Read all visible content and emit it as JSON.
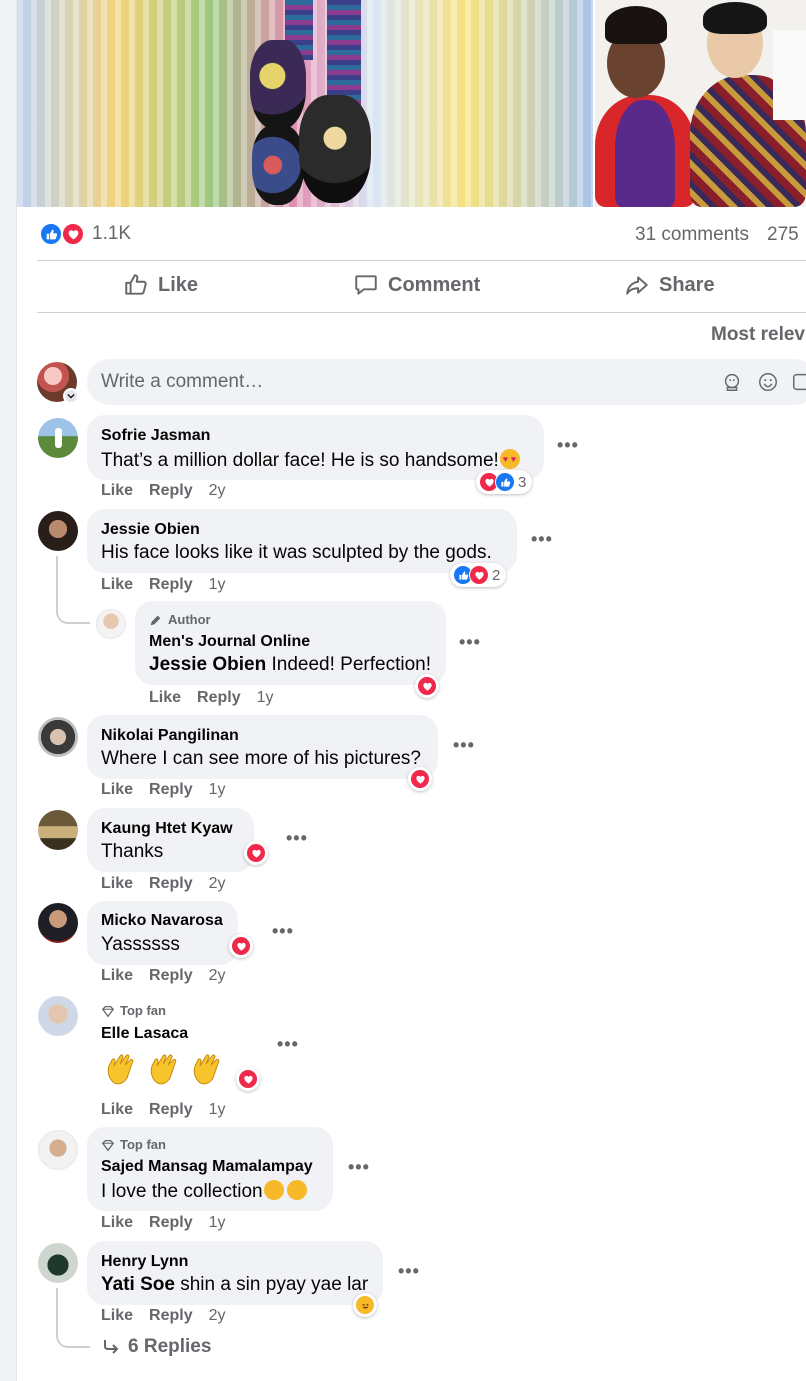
{
  "post": {
    "reaction_count": "1.1K",
    "comments_count": "31 comments",
    "shares_count": "275",
    "actions": {
      "like": "Like",
      "comment": "Comment",
      "share": "Share"
    },
    "sort_label": "Most relev"
  },
  "composer": {
    "placeholder": "Write a comment…"
  },
  "comments": [
    {
      "name": "Sofrie Jasman",
      "text": "That’s a million dollar face! He is so handsome!",
      "like": "Like",
      "reply": "Reply",
      "time": "2y",
      "reaction_count": "3"
    },
    {
      "name": "Jessie Obien",
      "text": "His face looks like it was sculpted by the gods.",
      "like": "Like",
      "reply": "Reply",
      "time": "1y",
      "reaction_count": "2"
    },
    {
      "badge": "Author",
      "name": "Men's Journal Online",
      "mention": "Jessie Obien",
      "text": " Indeed! Perfection!",
      "like": "Like",
      "reply": "Reply",
      "time": "1y"
    },
    {
      "name": "Nikolai Pangilinan",
      "text": "Where I can see more of his pictures?",
      "like": "Like",
      "reply": "Reply",
      "time": "1y"
    },
    {
      "name": "Kaung Htet Kyaw",
      "text": "Thanks",
      "like": "Like",
      "reply": "Reply",
      "time": "2y"
    },
    {
      "name": "Micko Navarosa",
      "text": "Yassssss",
      "like": "Like",
      "reply": "Reply",
      "time": "2y"
    },
    {
      "badge": "Top fan",
      "name": "Elle Lasaca",
      "like": "Like",
      "reply": "Reply",
      "time": "1y"
    },
    {
      "badge": "Top fan",
      "name": "Sajed Mansag Mamalampay",
      "text": "I love the collection",
      "like": "Like",
      "reply": "Reply",
      "time": "1y"
    },
    {
      "name": "Henry Lynn",
      "mention": "Yati Soe",
      "text": " shin a sin pyay yae lar",
      "like": "Like",
      "reply": "Reply",
      "time": "2y"
    }
  ],
  "replies_link": "6 Replies",
  "colors": {
    "like_blue": "#1877f2",
    "love_red": "#f02849",
    "secondary_text": "#65676b",
    "bubble_bg": "#f0f2f5"
  }
}
